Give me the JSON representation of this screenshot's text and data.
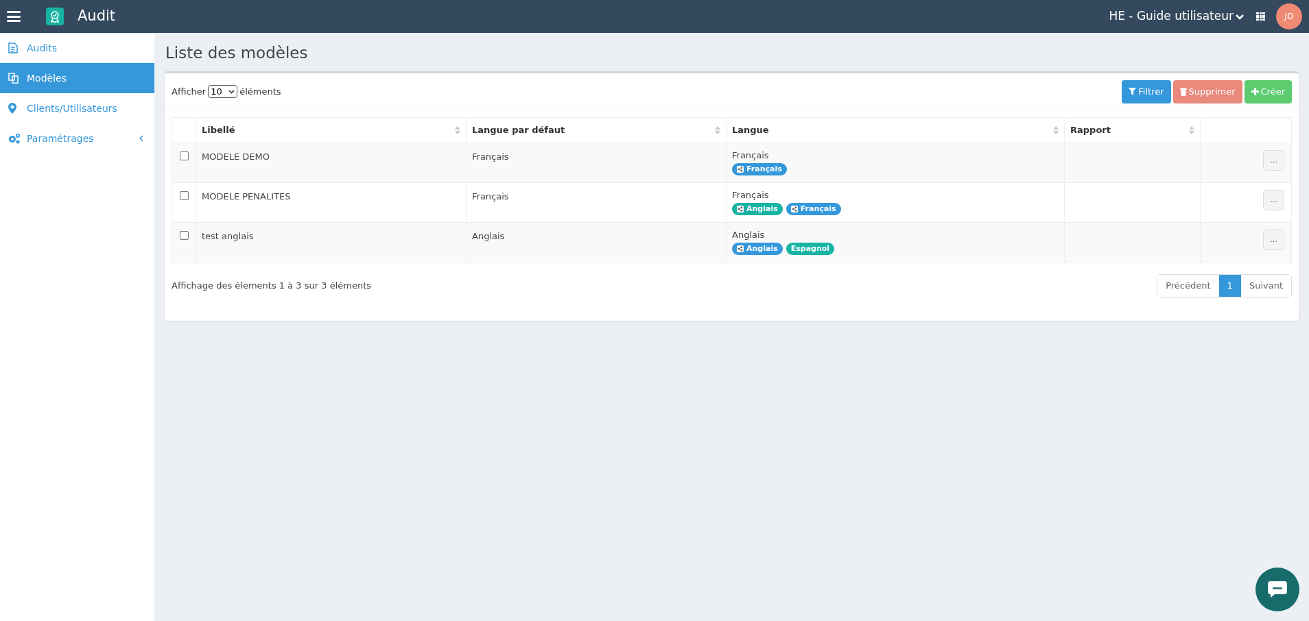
{
  "header": {
    "app_name": "Audit",
    "workspace": "HE - Guide utilisateur",
    "avatar": "JD"
  },
  "sidebar": {
    "items": [
      {
        "label": "Audits",
        "kind": "document",
        "selected": false
      },
      {
        "label": "Modèles",
        "kind": "copy",
        "selected": true
      },
      {
        "label": "Clients/Utilisateurs",
        "kind": "pin",
        "selected": false
      },
      {
        "label": "Paramétrages",
        "kind": "gears",
        "selected": false,
        "expandable": true
      }
    ]
  },
  "page_title": "Liste des modèles",
  "toolbar": {
    "show_prefix": "Afficher",
    "page_size": "10",
    "show_suffix": "éléments",
    "buttons": [
      {
        "label": "Filtrer",
        "kind": "filter"
      },
      {
        "label": "Supprimer",
        "kind": "delete"
      },
      {
        "label": "Créer",
        "kind": "create"
      }
    ]
  },
  "table": {
    "columns": [
      "Libellé",
      "Langue par défaut",
      "Langue",
      "Rapport"
    ],
    "rows": [
      {
        "checked": false,
        "name": "MODELE DEMO",
        "default_language": "Français",
        "language": "Français",
        "tags": [
          {
            "label": "Français",
            "shared": true,
            "color": "#3498db"
          }
        ],
        "action": "..."
      },
      {
        "checked": false,
        "name": "MODELE PENALITES",
        "default_language": "Français",
        "language": "Français",
        "tags": [
          {
            "label": "Anglais",
            "shared": true,
            "color": "#17b3a3"
          },
          {
            "label": "Français",
            "shared": true,
            "color": "#3498db"
          }
        ],
        "action": "..."
      },
      {
        "checked": false,
        "name": "test anglais",
        "default_language": "Anglais",
        "language": "Anglais",
        "tags": [
          {
            "label": "Anglais",
            "shared": true,
            "color": "#3498db"
          },
          {
            "label": "Espagnol",
            "shared": false,
            "color": "#17b3a3"
          }
        ],
        "action": "..."
      }
    ]
  },
  "footer": {
    "info": "Affichage des élements 1 à 3 sur 3 éléments",
    "pagination": [
      {
        "label": "Précédent",
        "selected": false
      },
      {
        "label": "1",
        "selected": true
      },
      {
        "label": "Suivant",
        "selected": false
      }
    ]
  }
}
